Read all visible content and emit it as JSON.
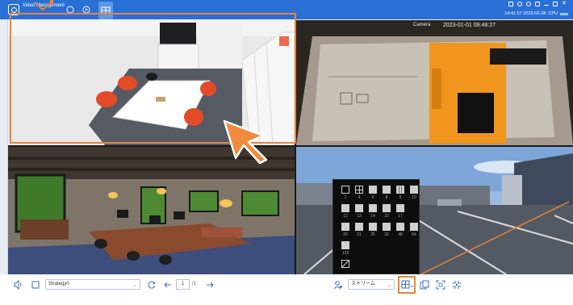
{
  "app": {
    "title": "Video Management"
  },
  "header": {
    "timestamp": "14:41:57 2023-02-28",
    "cpu_label": "CPU"
  },
  "channels": [
    {
      "name": "meeting-room"
    },
    {
      "name": "warehouse-box",
      "camera_label": "Camera",
      "osd_timestamp": "2023-01-01  09:48:27"
    },
    {
      "name": "office-open-plan"
    },
    {
      "name": "parking-lot"
    }
  ],
  "toolbar": {
    "strategy_value": "Strategy0",
    "page_current": "1",
    "page_total": "/1",
    "stream_value": "ストリーム"
  },
  "layout_menu": {
    "rows": [
      [
        "1",
        "4",
        "6",
        "8",
        "9",
        "10"
      ],
      [
        "12",
        "13",
        "14",
        "16",
        "17"
      ],
      [
        "20",
        "21",
        "25",
        "32",
        "48",
        "64"
      ],
      [
        "128"
      ],
      [
        ""
      ]
    ]
  },
  "colors": {
    "accent_highlight": "#e8833a",
    "titlebar": "#2a6fd6"
  }
}
